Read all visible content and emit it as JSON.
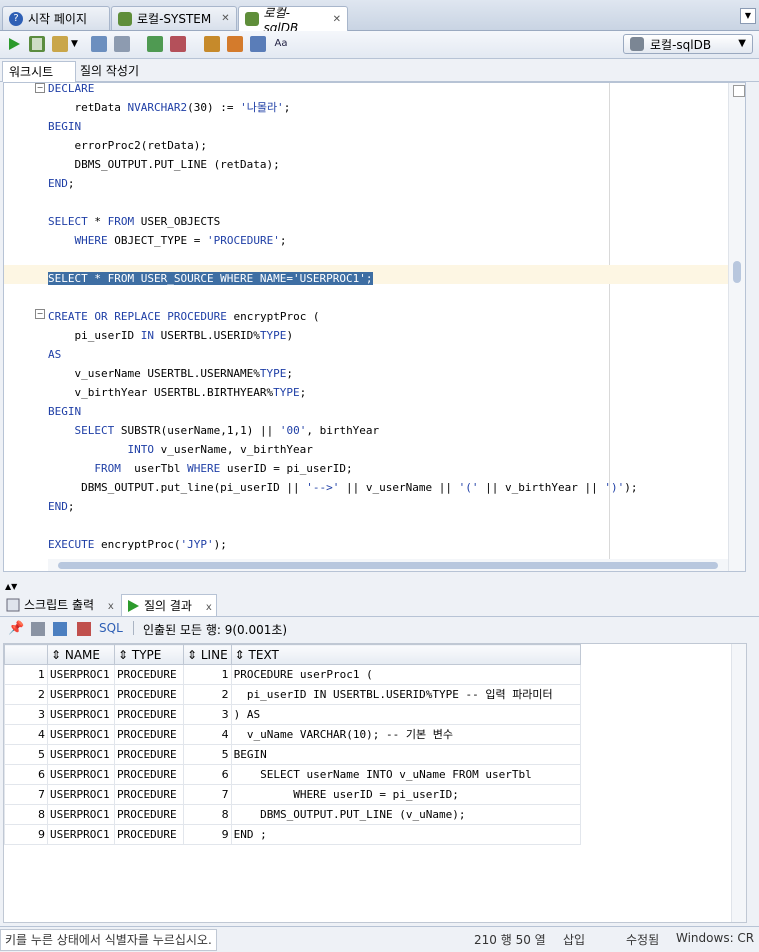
{
  "tabs": [
    {
      "label": "시작 페이지",
      "icon": "help-icon",
      "active": false
    },
    {
      "label": "로컬-SYSTEM",
      "icon": "db-connection-icon",
      "active": false
    },
    {
      "label": "로컬-sqlDB",
      "icon": "db-connection-icon",
      "active": true
    }
  ],
  "toolbar": {
    "connection": "로컬-sqlDB"
  },
  "worksheet_tabs": {
    "worksheet": "워크시트",
    "query_builder": "질의 작성기"
  },
  "bottom_tabs": {
    "script_output": "스크립트 출력",
    "query_result": "질의 결과",
    "close": "x"
  },
  "result_bar": {
    "sql_label": "SQL",
    "fetched_text": "인출된 모든 행: 9(0.001초)"
  },
  "grid": {
    "columns": [
      "NAME",
      "TYPE",
      "LINE",
      "TEXT"
    ],
    "rows": [
      [
        "1",
        "USERPROC1",
        "PROCEDURE",
        "1",
        "PROCEDURE userProc1 ("
      ],
      [
        "2",
        "USERPROC1",
        "PROCEDURE",
        "2",
        "  pi_userID IN USERTBL.USERID%TYPE -- 입력 파라미터"
      ],
      [
        "3",
        "USERPROC1",
        "PROCEDURE",
        "3",
        ") AS"
      ],
      [
        "4",
        "USERPROC1",
        "PROCEDURE",
        "4",
        "  v_uName VARCHAR(10); -- 기본 변수"
      ],
      [
        "5",
        "USERPROC1",
        "PROCEDURE",
        "5",
        "BEGIN"
      ],
      [
        "6",
        "USERPROC1",
        "PROCEDURE",
        "6",
        "    SELECT userName INTO v_uName FROM userTbl"
      ],
      [
        "7",
        "USERPROC1",
        "PROCEDURE",
        "7",
        "         WHERE userID = pi_userID;"
      ],
      [
        "8",
        "USERPROC1",
        "PROCEDURE",
        "8",
        "    DBMS_OUTPUT.PUT_LINE (v_uName);"
      ],
      [
        "9",
        "USERPROC1",
        "PROCEDURE",
        "9",
        "END ;"
      ]
    ]
  },
  "code_lines": [
    "DECLARE",
    "    retData NVARCHAR2(30) := '나몰라';",
    "BEGIN",
    "    errorProc2(retData);",
    "    DBMS_OUTPUT.PUT_LINE (retData);",
    "END;",
    "",
    "SELECT * FROM USER_OBJECTS",
    "    WHERE OBJECT_TYPE = 'PROCEDURE';",
    "",
    "SELECT * FROM USER_SOURCE WHERE NAME='USERPROC1';",
    "",
    "CREATE OR REPLACE PROCEDURE encryptProc (",
    "    pi_userID IN USERTBL.USERID%TYPE)",
    "AS",
    "    v_userName USERTBL.USERNAME%TYPE;",
    "    v_birthYear USERTBL.BIRTHYEAR%TYPE;",
    "BEGIN",
    "    SELECT SUBSTR(userName,1,1) || '00', birthYear",
    "            INTO v_userName, v_birthYear",
    "       FROM  userTbl WHERE userID = pi_userID;",
    "     DBMS_OUTPUT.put_line(pi_userID || '-->' || v_userName || '(' || v_birthYear || ')');",
    "END;",
    "",
    "EXECUTE encryptProc('JYP');"
  ],
  "status": {
    "message": "키를 누른 상태에서 식별자를 누르십시오.",
    "position": "210 행 50 열",
    "insert_mode": "삽입",
    "modified": "수정됨",
    "line_ending": "Windows: CR"
  }
}
